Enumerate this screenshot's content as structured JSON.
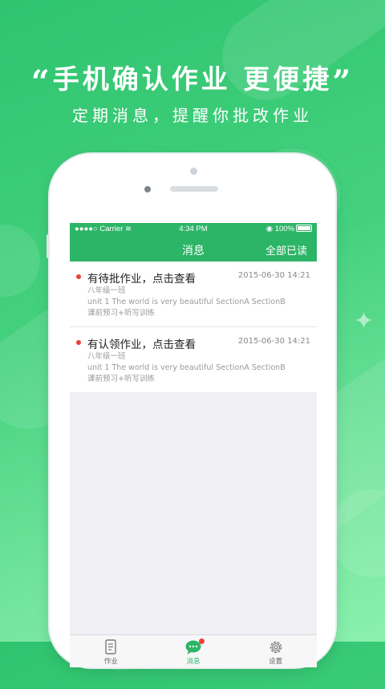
{
  "promo": {
    "open_quote": "“",
    "headline": "手机确认作业 更便捷",
    "close_quote": "”",
    "subline": "定期消息，提醒你批改作业"
  },
  "status_bar": {
    "carrier": "●●●●○ Carrier",
    "time": "4:34 PM",
    "battery": "100%"
  },
  "nav": {
    "title": "消息",
    "action": "全部已读"
  },
  "messages": [
    {
      "title": "有待批作业，点击查看",
      "time": "2015-06-30 14:21",
      "class": "八年级一班",
      "unit": "unit 1 The world is very beautiful  SectionA  SectionB",
      "task": "课前预习+听写训练"
    },
    {
      "title": "有认领作业，点击查看",
      "time": "2015-06-30 14:21",
      "class": "八年级一班",
      "unit": "unit 1 The world is very beautiful  SectionA  SectionB",
      "task": "课前预习+听写训练"
    }
  ],
  "tabs": {
    "homework": "作业",
    "messages": "消息",
    "settings": "设置"
  },
  "colors": {
    "brand_green": "#2db567",
    "unread_red": "#e8423b"
  }
}
